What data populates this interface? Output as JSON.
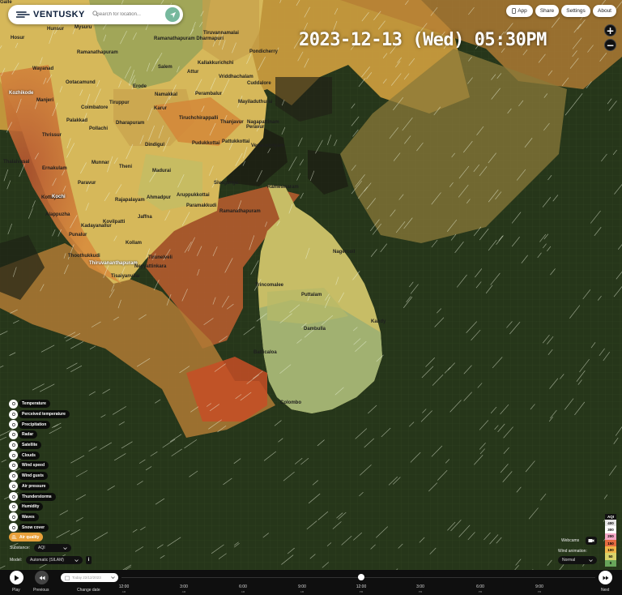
{
  "app": {
    "brand": "VENTUSKY"
  },
  "search": {
    "placeholder": "Search for location..."
  },
  "header_buttons": [
    {
      "label": "App",
      "icon": "phone-icon"
    },
    {
      "label": "Share"
    },
    {
      "label": "Settings"
    },
    {
      "label": "About"
    }
  ],
  "datetime": "2023-12-13 (Wed) 05:30PM",
  "zoom": {
    "in": "+",
    "out": "−"
  },
  "map_labels": {
    "cities": [
      "Hunsur",
      "Mysuru",
      "Ramanathapuram Dharmapuri",
      "Tiruvannamalai",
      "Hosur",
      "Salem",
      "Kallakkurichchi",
      "Pondicherry",
      "Wayanad",
      "Ramanathapuram",
      "Attur",
      "Cuddalore",
      "Perambalur",
      "Vriddhachalam",
      "Ootacamund",
      "Erode",
      "Namakkal",
      "Mayiladuthurai",
      "Kozhikode",
      "Manjeri",
      "Tiruppur",
      "Karur",
      "Nagapattinam",
      "Coimbatore",
      "Palakkad",
      "Dharapuram",
      "Tiruchchirappalli",
      "Thanjavur",
      "Peravur",
      "Vedaranniyam",
      "Pollachi",
      "Pudukkottai",
      "Pattukkottai",
      "Thrissur",
      "Ernakulam",
      "Dindigul",
      "Munnar",
      "Theni",
      "Madurai",
      "Kottayam",
      "Sivaganga",
      "Paravur",
      "Thalaivasal",
      "Ahmadpur",
      "Kochi",
      "Alappuzha",
      "Rajapalayam",
      "Aruppukkottai",
      "Paramakkudi",
      "Ramanathapuram",
      "Rameswaram",
      "Jaffna",
      "Kovilpatti",
      "Kadayanallur",
      "Punalur",
      "Kollam",
      "Tirunelveli",
      "Thoothukkudi",
      "Thiruvananthapuram",
      "Neyyattinkara",
      "Tisaiyanvilai",
      "Nagercoil",
      "Trincomalee",
      "Puttalam",
      "Dambulla",
      "Kandy",
      "Batticaloa",
      "Colombo",
      "Galle"
    ],
    "highlight": [
      "Kozhikode",
      "Kochi",
      "Thiruvananthapuram"
    ]
  },
  "layers": [
    {
      "label": "Temperature",
      "icon": "thermometer-icon"
    },
    {
      "label": "Perceived temperature",
      "icon": "thermometer-person-icon"
    },
    {
      "label": "Precipitation",
      "icon": "raindrop-icon"
    },
    {
      "label": "Radar",
      "icon": "radar-icon"
    },
    {
      "label": "Satellite",
      "icon": "satellite-icon"
    },
    {
      "label": "Clouds",
      "icon": "cloud-icon"
    },
    {
      "label": "Wind speed",
      "icon": "wind-icon"
    },
    {
      "label": "Wind gusts",
      "icon": "wind-gust-icon"
    },
    {
      "label": "Air pressure",
      "icon": "gauge-icon"
    },
    {
      "label": "Thunderstorms",
      "icon": "lightning-icon"
    },
    {
      "label": "Humidity",
      "icon": "humidity-icon"
    },
    {
      "label": "Waves",
      "icon": "waves-icon"
    },
    {
      "label": "Snow cover",
      "icon": "snowflake-icon"
    }
  ],
  "active_layer": {
    "label": "Air quality",
    "icon": "air-quality-icon"
  },
  "substance": {
    "label": "Substance:",
    "value": "AQI"
  },
  "model": {
    "label": "Model:",
    "value": "Automatic (SILAM)"
  },
  "right_controls": {
    "webcams": "Webcams",
    "wind_animation": "Wind animation:",
    "wind_animation_value": "Normal"
  },
  "legend": {
    "title": "AQI",
    "levels": [
      {
        "value": "400",
        "color": "#e6e6e6"
      },
      {
        "value": "300",
        "color": "#ffffff"
      },
      {
        "value": "200",
        "color": "#f4a8c6"
      },
      {
        "value": "150",
        "color": "#e56b41"
      },
      {
        "value": "100",
        "color": "#f0b64a"
      },
      {
        "value": "50",
        "color": "#d9d36a"
      },
      {
        "value": "0",
        "color": "#68a55a"
      }
    ]
  },
  "timeline": {
    "play": "Play",
    "previous": "Previous",
    "change_date": "Change date",
    "next": "Next",
    "date_input": "Today 22/12/2023",
    "ticks": [
      {
        "time": "12:00",
        "sub": "AM"
      },
      {
        "time": "3:00",
        "sub": "AM"
      },
      {
        "time": "6:00",
        "sub": "AM"
      },
      {
        "time": "9:00",
        "sub": "AM"
      },
      {
        "time": "12:00",
        "sub": "PM"
      },
      {
        "time": "3:00",
        "sub": "PM"
      },
      {
        "time": "6:00",
        "sub": "PM"
      },
      {
        "time": "9:00",
        "sub": "PM"
      }
    ]
  }
}
